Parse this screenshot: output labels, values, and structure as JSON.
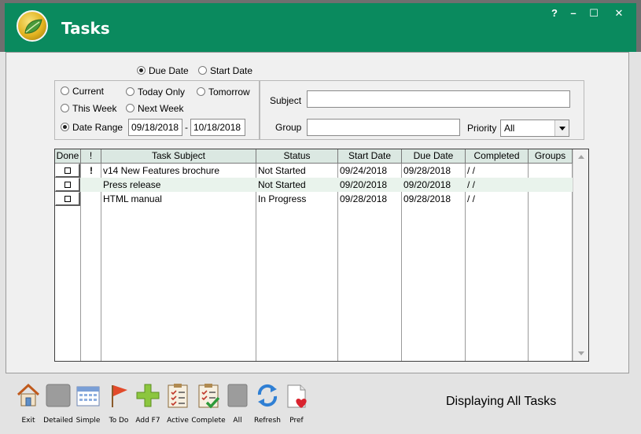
{
  "window": {
    "title": "Tasks",
    "controls": {
      "help": "?",
      "minimize": "–",
      "maximize": "☐",
      "close": "✕"
    }
  },
  "date_type": {
    "due_date": "Due Date",
    "start_date": "Start Date",
    "selected": "due_date"
  },
  "date_range": {
    "current": "Current",
    "today_only": "Today Only",
    "tomorrow": "Tomorrow",
    "this_week": "This Week",
    "next_week": "Next Week",
    "date_range": "Date Range",
    "selected": "date_range",
    "from": "09/18/2018",
    "separator": "-",
    "to": "10/18/2018"
  },
  "filters": {
    "subject_label": "Subject",
    "subject_value": "",
    "group_label": "Group",
    "group_value": "",
    "priority_label": "Priority",
    "priority_value": "All"
  },
  "table": {
    "columns": [
      "Done",
      "!",
      "Task Subject",
      "Status",
      "Start Date",
      "Due Date",
      "Completed",
      "Groups"
    ],
    "rows": [
      {
        "done": false,
        "priority": "!",
        "subject": "v14 New Features brochure",
        "status": "Not Started",
        "start": "09/24/2018",
        "due": "09/28/2018",
        "completed": "/ /",
        "groups": ""
      },
      {
        "done": false,
        "priority": "",
        "subject": "Press release",
        "status": "Not Started",
        "start": "09/20/2018",
        "due": "09/20/2018",
        "completed": "/ /",
        "groups": ""
      },
      {
        "done": false,
        "priority": "",
        "subject": "HTML manual",
        "status": "In Progress",
        "start": "09/28/2018",
        "due": "09/28/2018",
        "completed": "/ /",
        "groups": ""
      }
    ]
  },
  "toolbar": [
    {
      "label": "Exit",
      "icon": "home-icon"
    },
    {
      "label": "Detailed",
      "icon": "detailed-view-icon"
    },
    {
      "label": "Simple",
      "icon": "calendar-icon"
    },
    {
      "label": "To Do",
      "icon": "flag-icon"
    },
    {
      "label": "Add F7",
      "icon": "plus-icon"
    },
    {
      "label": "Active",
      "icon": "checklist-icon"
    },
    {
      "label": "Complete",
      "icon": "checklist-complete-icon"
    },
    {
      "label": "All",
      "icon": "all-icon"
    },
    {
      "label": "Refresh",
      "icon": "refresh-icon"
    },
    {
      "label": "Pref",
      "icon": "preferences-icon"
    }
  ],
  "status": {
    "text": "Displaying All Tasks"
  },
  "colors": {
    "header_green": "#0a8a5e",
    "row_alt": "#e9f3ec",
    "column_header": "#dbe8e2"
  }
}
